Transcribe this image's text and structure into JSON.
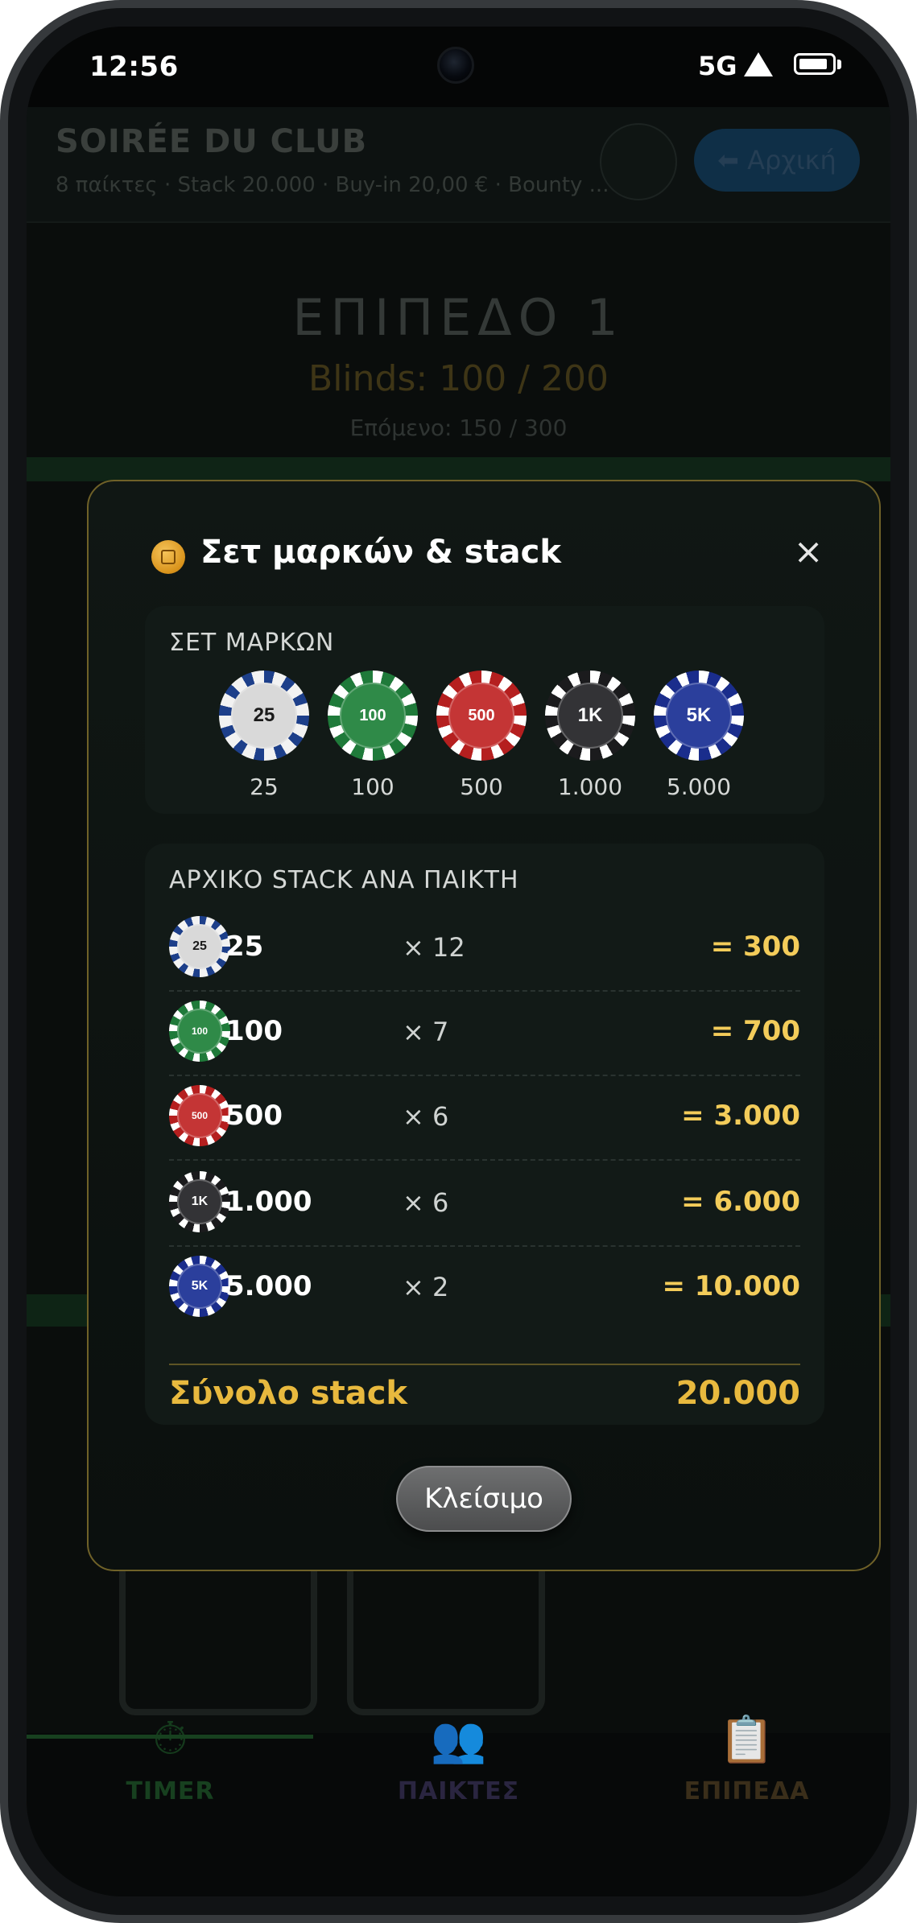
{
  "status_bar": {
    "time": "12:56",
    "network": "5G"
  },
  "header": {
    "title": "SOIRÉE DU CLUB",
    "subtitle": "8 παίκτες · Stack 20.000 · Buy-in 20,00 € · Bounty ...",
    "home_button": "⬅ Αρχική"
  },
  "timer": {
    "level": "ΕΠΙΠΕΔΟ 1",
    "blinds": "Blinds: 100 / 200",
    "next": "Επόμενο: 150 / 300"
  },
  "tabs": [
    {
      "label": "TIMER",
      "icon": "stopwatch-icon",
      "color": "#17401f"
    },
    {
      "label": "ΠΑΙΚΤΕΣ",
      "icon": "players-icon",
      "color": "#2a2540"
    },
    {
      "label": "ΕΠΙΠΕΔΑ",
      "icon": "clipboard-icon",
      "color": "#3a2e1a"
    }
  ],
  "modal": {
    "title": "Σετ μαρκών & stack",
    "close_symbol": "×",
    "chipset_label": "ΣΕΤ ΜΑΡΚΩΝ",
    "chips": [
      {
        "face": "25",
        "caption": "25",
        "color": "#f2f2f2",
        "accent": "#1d3f8a",
        "text_color": "#1a1a1a"
      },
      {
        "face": "100",
        "caption": "100",
        "color": "#1f7a3a",
        "accent": "#ffffff",
        "text_color": "#ffffff"
      },
      {
        "face": "500",
        "caption": "500",
        "color": "#b51f1f",
        "accent": "#ffffff",
        "text_color": "#ffffff"
      },
      {
        "face": "1K",
        "caption": "1.000",
        "color": "#1b1b1d",
        "accent": "#ffffff",
        "text_color": "#ffffff"
      },
      {
        "face": "5K",
        "caption": "5.000",
        "color": "#1a2d8c",
        "accent": "#ffffff",
        "text_color": "#ffffff"
      }
    ],
    "stack_label": "ΑΡΧΙΚΟ STACK ΑΝΑ ΠΑΙΚΤΗ",
    "stack_rows": [
      {
        "name": "25",
        "multiplier": "× 12",
        "subtotal": "= 300"
      },
      {
        "name": "100",
        "multiplier": "× 7",
        "subtotal": "= 700"
      },
      {
        "name": "500",
        "multiplier": "× 6",
        "subtotal": "= 3.000"
      },
      {
        "name": "1.000",
        "multiplier": "× 6",
        "subtotal": "= 6.000"
      },
      {
        "name": "5.000",
        "multiplier": "× 2",
        "subtotal": "= 10.000"
      }
    ],
    "total_label": "Σύνολο stack",
    "total_value": "20.000",
    "close_button": "Κλείσιμο"
  }
}
